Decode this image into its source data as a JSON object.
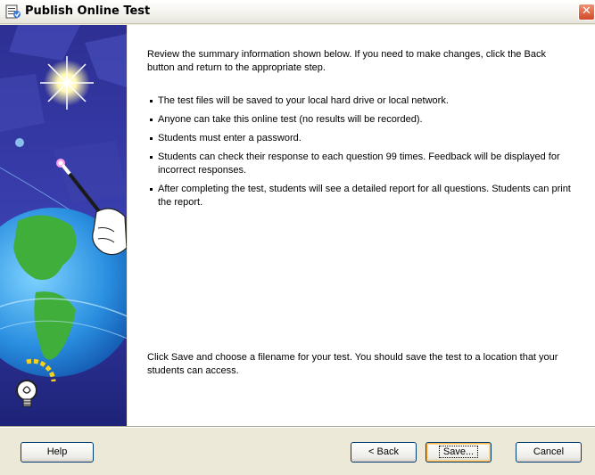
{
  "window": {
    "title": "Publish Online Test",
    "close_glyph": "✕"
  },
  "summary": {
    "intro": "Review the summary information shown below.  If you need to make changes, click the Back button and return to the appropriate step.",
    "bullets": [
      "The test files will be saved to your local hard drive or local network.",
      "Anyone can take this online test (no results will be recorded).",
      "Students must enter a password.",
      "Students can check their response to each question 99 times.  Feedback will be displayed for incorrect responses.",
      "After completing the test, students will see a detailed report for all questions.  Students can print the report."
    ],
    "footer": "Click Save and choose a filename for your test.  You should save the test to a location that your students can access."
  },
  "buttons": {
    "help": "Help",
    "back": "< Back",
    "save": "Save...",
    "cancel": "Cancel"
  },
  "icons": {
    "app": "publish-test-icon",
    "close": "close-icon",
    "wizard_art": "globe-magic-wand-illustration",
    "lightbulb": "lightbulb-icon"
  },
  "colors": {
    "wizard_bg": "#2b2f9a",
    "close_red": "#d24a28",
    "button_border": "#003c74",
    "default_button_highlight": "#ffb84a"
  }
}
